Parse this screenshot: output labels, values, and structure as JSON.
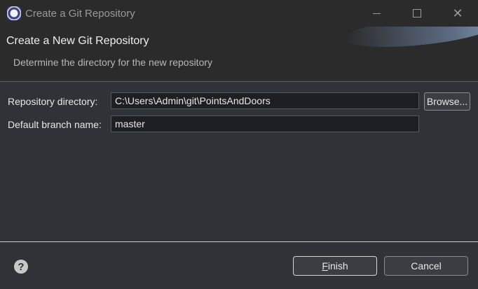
{
  "window": {
    "title": "Create a Git Repository",
    "icon": "eclipse-icon"
  },
  "banner": {
    "title": "Create a New Git Repository",
    "description": "Determine the directory for the new repository"
  },
  "form": {
    "repo_dir_label": "Repository directory:",
    "repo_dir_value": "C:\\Users\\Admin\\git\\PointsAndDoors",
    "browse_label": "Browse...",
    "branch_label": "Default branch name:",
    "branch_value": "master"
  },
  "footer": {
    "help_icon": "help-icon",
    "finish_mnemonic": "F",
    "finish_rest": "inish",
    "cancel_label": "Cancel"
  },
  "colors": {
    "background": "#2f3237",
    "titlebar": "#2b2b2b",
    "field_background": "#1e1f22",
    "text": "#e8e8e8"
  }
}
